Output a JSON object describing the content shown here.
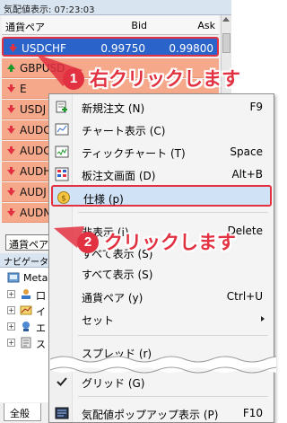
{
  "market_watch": {
    "title": "気配値表示: 07:23:03",
    "columns": {
      "symbol": "通貨ペア",
      "bid": "Bid",
      "ask": "Ask"
    },
    "rows": [
      {
        "symbol": "USDCHF",
        "bid": "0.99750",
        "ask": "0.99800",
        "direction": "down",
        "selected": true
      },
      {
        "symbol": "GBPUSD",
        "bid": "",
        "ask": "",
        "direction": "up",
        "selected": false
      },
      {
        "symbol": "E",
        "bid": "",
        "ask": "",
        "direction": "down",
        "selected": false
      },
      {
        "symbol": "USDJ",
        "bid": "",
        "ask": "",
        "direction": "down",
        "selected": false
      },
      {
        "symbol": "AUDC",
        "bid": "",
        "ask": "",
        "direction": "down",
        "selected": false
      },
      {
        "symbol": "AUDC",
        "bid": "",
        "ask": "",
        "direction": "down",
        "selected": false
      },
      {
        "symbol": "AUDH",
        "bid": "",
        "ask": "",
        "direction": "down",
        "selected": false
      },
      {
        "symbol": "AUDJ",
        "bid": "",
        "ask": "",
        "direction": "down",
        "selected": false
      },
      {
        "symbol": "AUDN",
        "bid": "",
        "ask": "",
        "direction": "down",
        "selected": false
      }
    ],
    "tooltip": "通貨ペア"
  },
  "navigator": {
    "title": "ナビゲータ",
    "items": [
      {
        "label": "Meta",
        "expander": ""
      },
      {
        "label": "口",
        "expander": "+"
      },
      {
        "label": "イ",
        "expander": "+"
      },
      {
        "label": "エ",
        "expander": "+"
      },
      {
        "label": "ス",
        "expander": "+"
      }
    ],
    "tab": "全般"
  },
  "context_menu": {
    "items": [
      {
        "label": "新規注文 (N)",
        "shortcut": "F9",
        "icon": "new-order-icon"
      },
      {
        "label": "チャート表示 (C)",
        "shortcut": "",
        "icon": "chart-icon"
      },
      {
        "label": "ティックチャート (T)",
        "shortcut": "Space",
        "icon": "tick-chart-icon"
      },
      {
        "label": "板注文画面 (D)",
        "shortcut": "Alt+B",
        "icon": "order-board-icon"
      },
      {
        "label": "仕様 (p)",
        "shortcut": "",
        "icon": "specification-icon",
        "highlighted": true
      },
      {
        "label": "非表示 (i)",
        "shortcut": "Delete",
        "icon": ""
      },
      {
        "label": "すべて表示 (S)",
        "shortcut": "",
        "icon": ""
      },
      {
        "label": "すべて表示 (S)",
        "shortcut": "",
        "icon": ""
      },
      {
        "label": "通貨ペア (y)",
        "shortcut": "Ctrl+U",
        "icon": ""
      },
      {
        "label": "セット",
        "shortcut": "",
        "icon": "",
        "submenu": true
      },
      {
        "label": "スプレッド (r)",
        "shortcut": "",
        "icon": ""
      },
      {
        "label": "グリッド (G)",
        "shortcut": "",
        "icon": "check-icon"
      },
      {
        "label": "気配値ポップアップ表示 (P)",
        "shortcut": "F10",
        "icon": "popup-icon"
      }
    ]
  },
  "annotations": {
    "step1": {
      "number": "1",
      "text": "右クリックします"
    },
    "step2": {
      "number": "2",
      "text": "クリックします"
    },
    "accent_color": "#e23241"
  }
}
